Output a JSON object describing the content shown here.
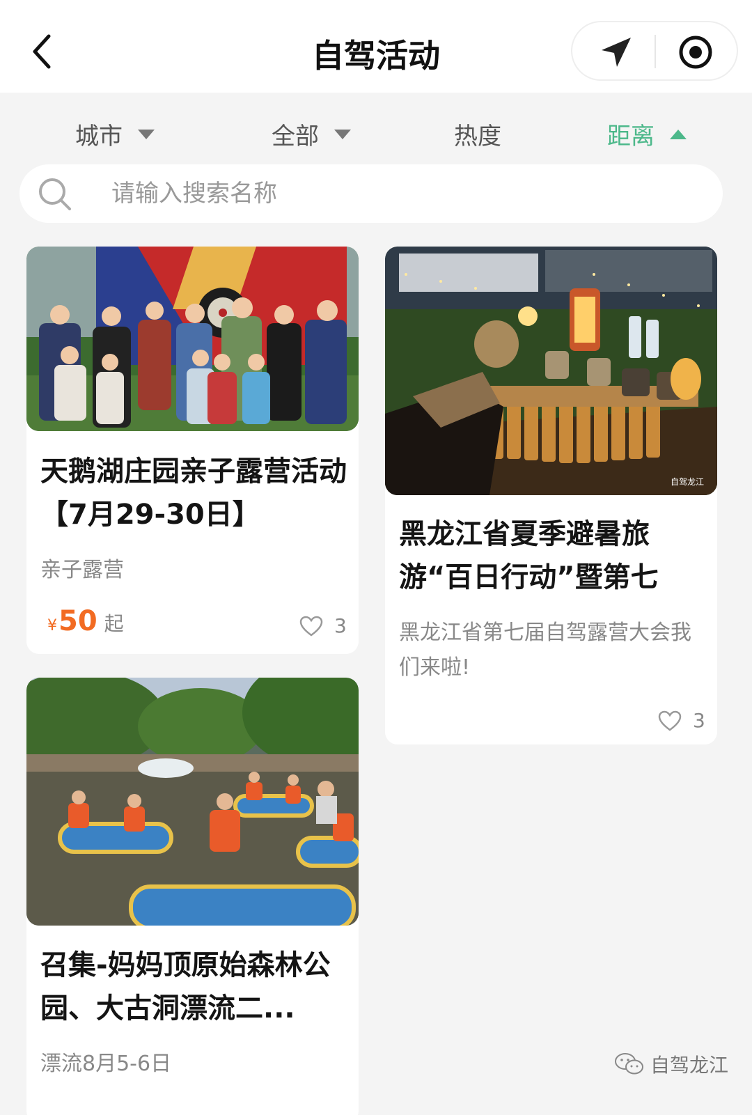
{
  "header": {
    "title": "自驾活动"
  },
  "filters": [
    {
      "label": "城市",
      "arrow": "down",
      "active": false
    },
    {
      "label": "全部",
      "arrow": "down",
      "active": false
    },
    {
      "label": "热度",
      "arrow": "none",
      "active": false
    },
    {
      "label": "距离",
      "arrow": "up",
      "active": true
    }
  ],
  "search": {
    "placeholder": "请输入搜索名称",
    "value": ""
  },
  "cards": [
    {
      "title": "天鹅湖庄园亲子露营活动【7月29-30日】",
      "subtitle": "亲子露营",
      "price_symbol": "¥",
      "price": "50",
      "price_suffix": "起",
      "likes": "3"
    },
    {
      "title": "黑龙江省夏季避暑旅游“百日行动”暨第七",
      "subtitle": "黑龙江省第七届自驾露营大会我们来啦!",
      "image_watermark": "自驾龙江",
      "likes": "3"
    },
    {
      "title": "召集-妈妈顶原始森林公园、大古洞漂流二...",
      "subtitle": "漂流8月5-6日"
    }
  ],
  "watermark": {
    "text": "自驾龙江"
  },
  "colors": {
    "accent": "#4cb88a",
    "price": "#f26b22",
    "background": "#f4f4f4"
  }
}
